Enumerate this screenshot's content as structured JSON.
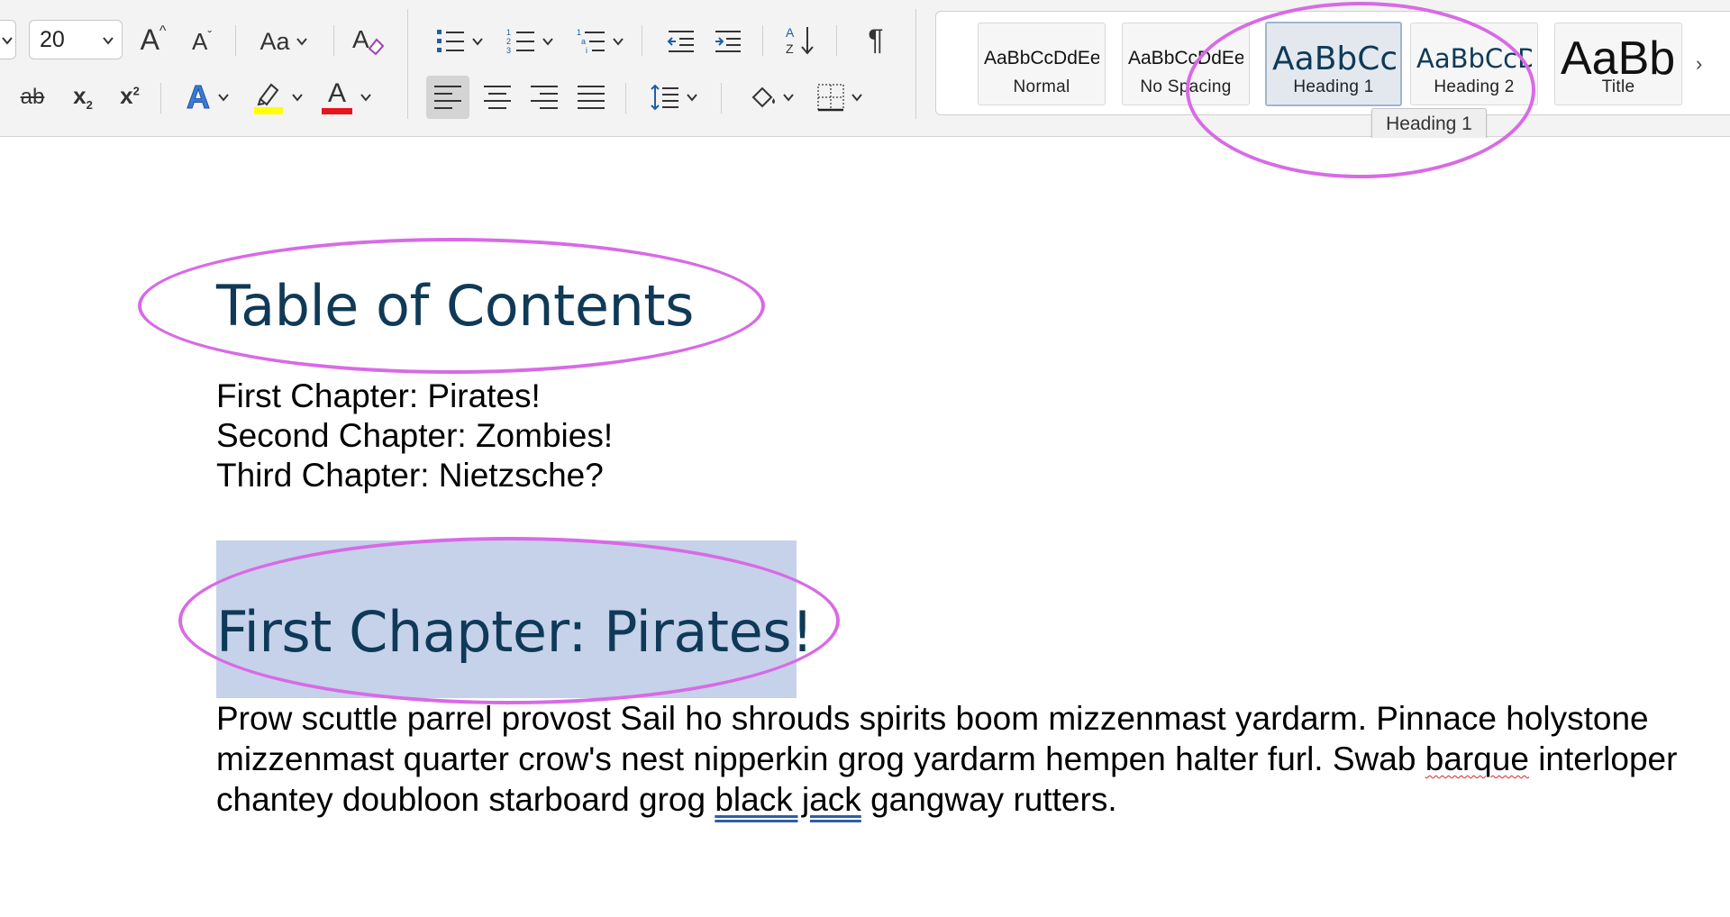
{
  "ribbon": {
    "font_size": "20",
    "styles": [
      {
        "preview": "AaBbCcDdEe",
        "name": "Normal"
      },
      {
        "preview": "AaBbCcDdEe",
        "name": "No Spacing"
      },
      {
        "preview": "AaBbCc",
        "name": "Heading 1"
      },
      {
        "preview": "AaBbCcDd",
        "name": "Heading 2"
      },
      {
        "preview": "AaBb",
        "name": "Title"
      }
    ],
    "selected_style": "Heading 1",
    "tooltip": "Heading 1",
    "icons": {
      "change_case": "Aa",
      "pilcrow": "¶",
      "subscript_base": "x",
      "subscript_sub": "2",
      "superscript_base": "x",
      "superscript_sup": "2",
      "strikethrough": "ab",
      "text_effects": "A",
      "font_color": "A",
      "grow_font": "A",
      "shrink_font": "A"
    },
    "colors": {
      "highlight": "#ffff00",
      "font_color": "#e8141c",
      "callout": "#d86ae6",
      "heading": "#0f3a57",
      "selection": "#c5d2ea"
    }
  },
  "document": {
    "toc_title": "Table of Contents",
    "toc_items": [
      "First Chapter: Pirates!",
      "Second Chapter: Zombies!",
      "Third Chapter: Nietzsche?"
    ],
    "chapter_title": "First Chapter: Pirates!",
    "paragraph": {
      "line1": "Prow scuttle parrel provost Sail ho shrouds spirits boom mizzenmast yardarm. Pinnace holystone mizzenmast quarter crow's nest nipperkin grog yardarm hempen halter furl. Swab",
      "misspelled": "barque",
      "middle": " interloper chantey doubloon starboard grog ",
      "grammar": "black jack",
      "end": " gangway rutters."
    }
  }
}
